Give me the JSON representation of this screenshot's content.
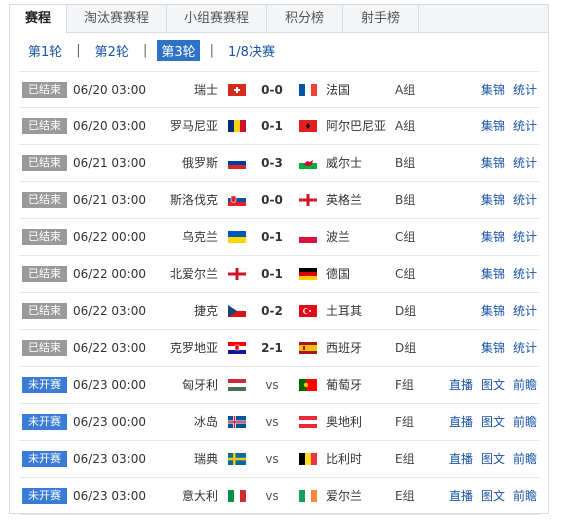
{
  "tabs": [
    {
      "label": "赛程",
      "active": true
    },
    {
      "label": "淘汰赛赛程",
      "active": false
    },
    {
      "label": "小组赛赛程",
      "active": false
    },
    {
      "label": "积分榜",
      "active": false
    },
    {
      "label": "射手榜",
      "active": false
    }
  ],
  "rounds": [
    {
      "label": "第1轮",
      "active": false
    },
    {
      "label": "第2轮",
      "active": false
    },
    {
      "label": "第3轮",
      "active": true
    },
    {
      "label": "1/8决赛",
      "active": false
    }
  ],
  "round_separator": "|",
  "colors": {
    "finished": "#9a9a9a",
    "upcoming": "#3a7bd5",
    "link": "#1a54a8"
  },
  "matches": [
    {
      "status": "已结束",
      "state": "finished",
      "time": "06/20 03:00",
      "home": "瑞士",
      "home_flag": "switzerland",
      "score": "0-0",
      "away": "法国",
      "away_flag": "france",
      "group": "A组",
      "links": [
        "集锦",
        "统计"
      ]
    },
    {
      "status": "已结束",
      "state": "finished",
      "time": "06/20 03:00",
      "home": "罗马尼亚",
      "home_flag": "romania",
      "score": "0-1",
      "away": "阿尔巴尼亚",
      "away_flag": "albania",
      "group": "A组",
      "links": [
        "集锦",
        "统计"
      ]
    },
    {
      "status": "已结束",
      "state": "finished",
      "time": "06/21 03:00",
      "home": "俄罗斯",
      "home_flag": "russia",
      "score": "0-3",
      "away": "威尔士",
      "away_flag": "wales",
      "group": "B组",
      "links": [
        "集锦",
        "统计"
      ]
    },
    {
      "status": "已结束",
      "state": "finished",
      "time": "06/21 03:00",
      "home": "斯洛伐克",
      "home_flag": "slovakia",
      "score": "0-0",
      "away": "英格兰",
      "away_flag": "england",
      "group": "B组",
      "links": [
        "集锦",
        "统计"
      ]
    },
    {
      "status": "已结束",
      "state": "finished",
      "time": "06/22 00:00",
      "home": "乌克兰",
      "home_flag": "ukraine",
      "score": "0-1",
      "away": "波兰",
      "away_flag": "poland",
      "group": "C组",
      "links": [
        "集锦",
        "统计"
      ]
    },
    {
      "status": "已结束",
      "state": "finished",
      "time": "06/22 00:00",
      "home": "北爱尔兰",
      "home_flag": "northern-ireland",
      "score": "0-1",
      "away": "德国",
      "away_flag": "germany",
      "group": "C组",
      "links": [
        "集锦",
        "统计"
      ]
    },
    {
      "status": "已结束",
      "state": "finished",
      "time": "06/22 03:00",
      "home": "捷克",
      "home_flag": "czech",
      "score": "0-2",
      "away": "土耳其",
      "away_flag": "turkey",
      "group": "D组",
      "links": [
        "集锦",
        "统计"
      ]
    },
    {
      "status": "已结束",
      "state": "finished",
      "time": "06/22 03:00",
      "home": "克罗地亚",
      "home_flag": "croatia",
      "score": "2-1",
      "away": "西班牙",
      "away_flag": "spain",
      "group": "D组",
      "links": [
        "集锦",
        "统计"
      ]
    },
    {
      "status": "未开赛",
      "state": "upcoming",
      "time": "06/23 00:00",
      "home": "匈牙利",
      "home_flag": "hungary",
      "score": "vs",
      "away": "葡萄牙",
      "away_flag": "portugal",
      "group": "F组",
      "links": [
        "直播",
        "图文",
        "前瞻"
      ]
    },
    {
      "status": "未开赛",
      "state": "upcoming",
      "time": "06/23 00:00",
      "home": "冰岛",
      "home_flag": "iceland",
      "score": "vs",
      "away": "奥地利",
      "away_flag": "austria",
      "group": "F组",
      "links": [
        "直播",
        "图文",
        "前瞻"
      ]
    },
    {
      "status": "未开赛",
      "state": "upcoming",
      "time": "06/23 03:00",
      "home": "瑞典",
      "home_flag": "sweden",
      "score": "vs",
      "away": "比利时",
      "away_flag": "belgium",
      "group": "E组",
      "links": [
        "直播",
        "图文",
        "前瞻"
      ]
    },
    {
      "status": "未开赛",
      "state": "upcoming",
      "time": "06/23 03:00",
      "home": "意大利",
      "home_flag": "italy",
      "score": "vs",
      "away": "爱尔兰",
      "away_flag": "ireland",
      "group": "E组",
      "links": [
        "直播",
        "图文",
        "前瞻"
      ]
    }
  ]
}
